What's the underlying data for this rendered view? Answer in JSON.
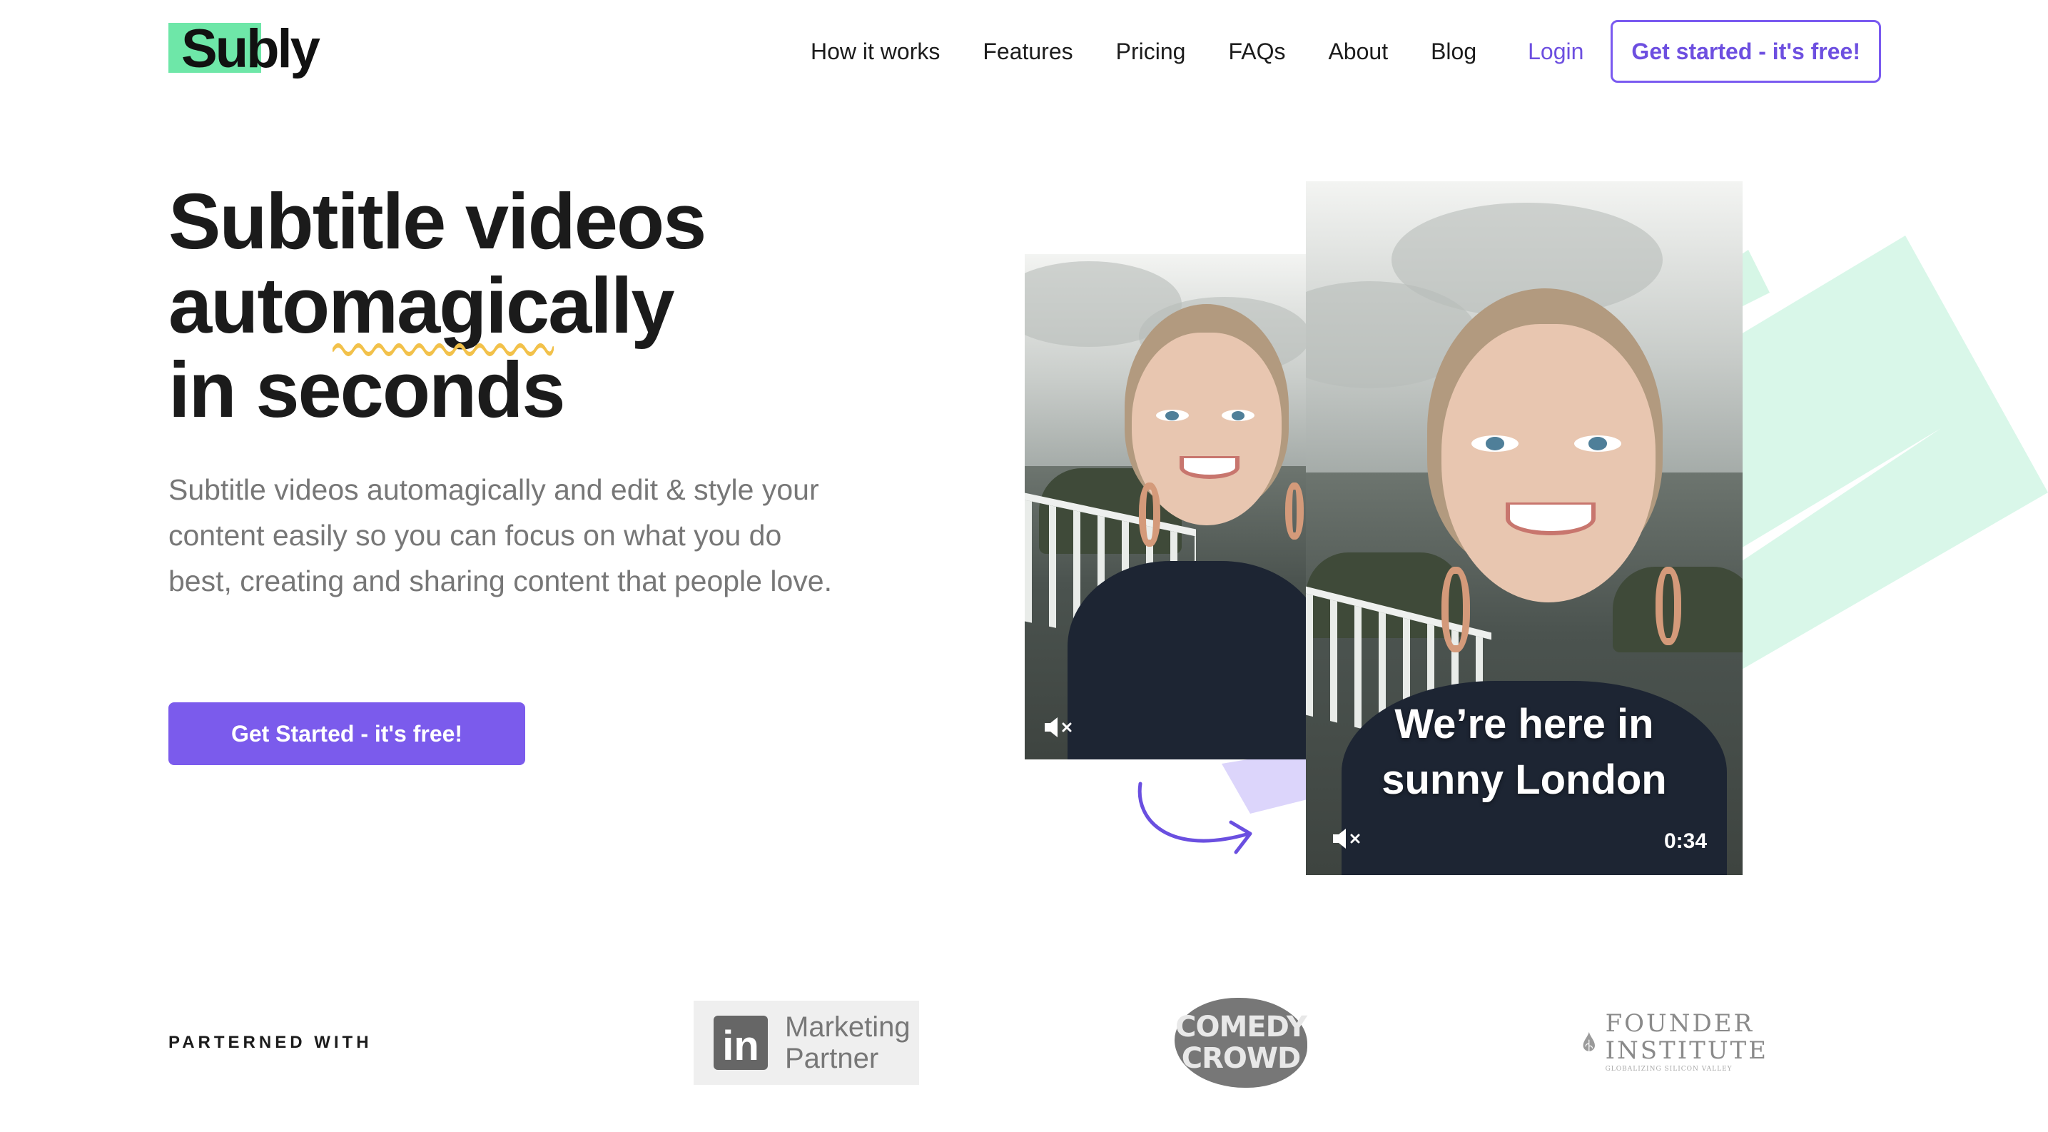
{
  "brand": {
    "name": "Subly",
    "accent_color": "#6ee7a8",
    "primary_color": "#7b5bec"
  },
  "nav": {
    "links": [
      "How it works",
      "Features",
      "Pricing",
      "FAQs",
      "About",
      "Blog"
    ],
    "login": "Login",
    "cta": "Get started - it's free!"
  },
  "hero": {
    "title_line1": "Subtitle videos",
    "title_line2": "automagically",
    "title_line3": "in seconds",
    "description": "Subtitle videos automagically and edit & style your content easily so you can focus on what you do best, creating and sharing content that people love.",
    "cta": "Get Started - it's free!"
  },
  "video_preview": {
    "caption_line1": "We’re here in",
    "caption_line2": "sunny London",
    "duration": "0:34",
    "small_icon": "mute-icon",
    "large_icon": "mute-icon"
  },
  "partners": {
    "label": "PARTERNED WITH",
    "linkedin": {
      "mark": "in",
      "line1": "Marketing",
      "line2": "Partner"
    },
    "comedy_crowd": {
      "line1": "COMEDY",
      "line2": "CROWD"
    },
    "founder_institute": {
      "line1": "FOUNDER",
      "line2": "INSTITUTE",
      "tagline": "GLOBALIZING SILICON VALLEY"
    }
  }
}
